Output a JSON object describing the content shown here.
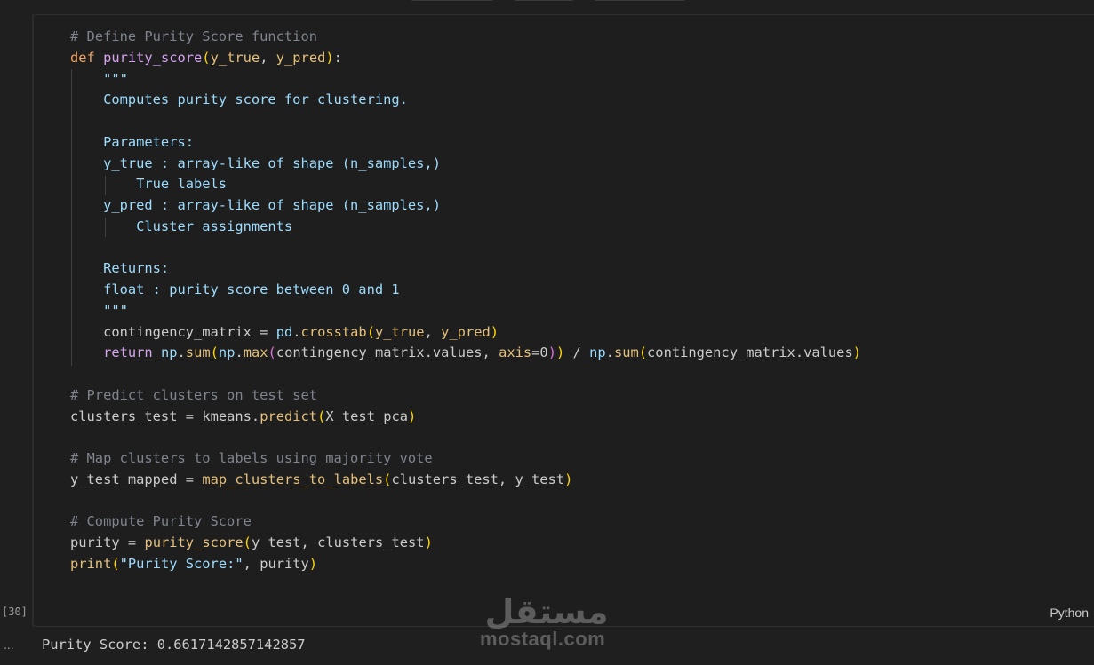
{
  "cell": {
    "language": "Python",
    "execution_count": "[30]",
    "code_lines": [
      "# Define Purity Score function",
      "def purity_score(y_true, y_pred):",
      "    \"\"\"",
      "    Computes purity score for clustering.",
      "",
      "    Parameters:",
      "    y_true : array-like of shape (n_samples,)",
      "        True labels",
      "    y_pred : array-like of shape (n_samples,)",
      "        Cluster assignments",
      "",
      "    Returns:",
      "    float : purity score between 0 and 1",
      "    \"\"\"",
      "    contingency_matrix = pd.crosstab(y_true, y_pred)",
      "    return np.sum(np.max(contingency_matrix.values, axis=0)) / np.sum(contingency_matrix.values)",
      "",
      "# Predict clusters on test set",
      "clusters_test = kmeans.predict(X_test_pca)",
      "",
      "# Map clusters to labels using majority vote",
      "y_test_mapped = map_clusters_to_labels(clusters_test, y_test)",
      "",
      "# Compute Purity Score",
      "purity = purity_score(y_test, clusters_test)",
      "print(\"Purity Score:\", purity)"
    ]
  },
  "output": {
    "dots": "...",
    "text": "Purity Score: 0.6617142857142857"
  },
  "watermark": {
    "arabic": "مستقل",
    "latin": "mostaql.com"
  }
}
